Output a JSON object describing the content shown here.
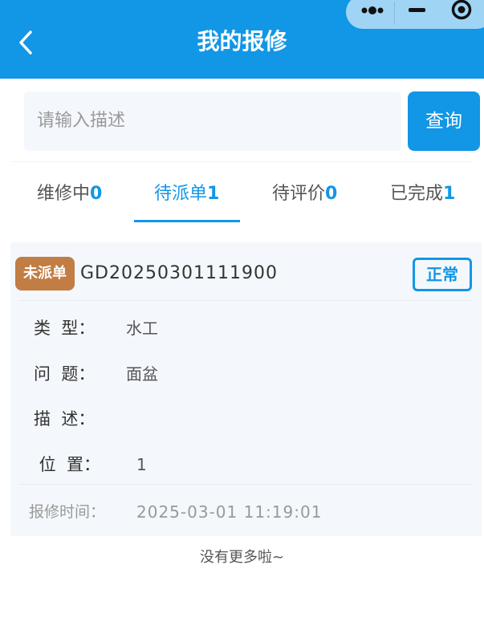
{
  "header": {
    "title": "我的报修"
  },
  "search": {
    "placeholder": "请输入描述",
    "button_label": "查询"
  },
  "tabs": [
    {
      "label": "维修中",
      "count": "0",
      "active": false
    },
    {
      "label": "待派单",
      "count": "1",
      "active": true
    },
    {
      "label": "待评价",
      "count": "0",
      "active": false
    },
    {
      "label": "已完成",
      "count": "1",
      "active": false
    }
  ],
  "order": {
    "badge": "未派单",
    "number": "GD20250301111900",
    "status": "正常",
    "fields": [
      {
        "label": "类  型：",
        "value": "水工"
      },
      {
        "label": "问  题：",
        "value": "面盆"
      },
      {
        "label": "描  述：",
        "value": ""
      },
      {
        "label": " 位  置：",
        "value": "1"
      }
    ],
    "time_label": "报修时间：",
    "time_value": "2025-03-01 11:19:01"
  },
  "footer": {
    "text": "没有更多啦~"
  },
  "colors": {
    "primary": "#1296e6",
    "badge": "#c17d44",
    "card_bg": "#f4f8fc"
  }
}
